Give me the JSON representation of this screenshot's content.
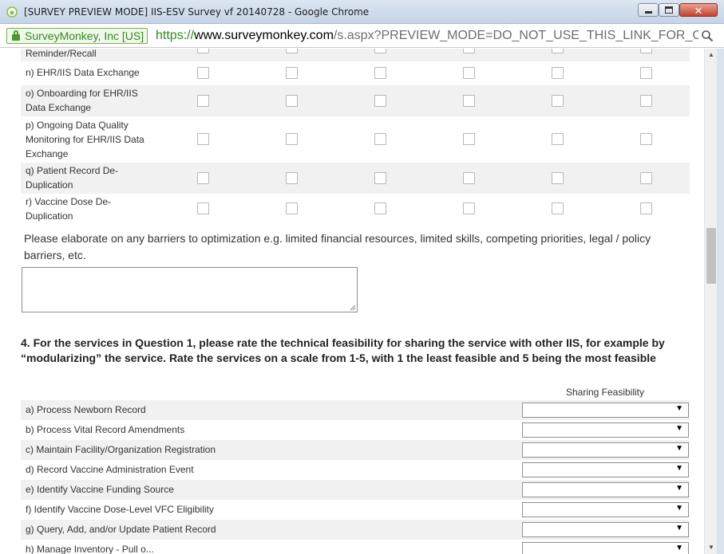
{
  "window": {
    "title": "[SURVEY PREVIEW MODE] IIS-ESV Survey vf 20140728 - Google Chrome",
    "close_glyph": "✕"
  },
  "address": {
    "ev_label": "SurveyMonkey, Inc [US]",
    "scheme": "https://",
    "host": "www.surveymonkey.com",
    "path": "/s.aspx?PREVIEW_MODE=DO_NOT_USE_THIS_LINK_FOR_COLLECTION"
  },
  "matrix": {
    "rows": [
      {
        "label": "Reminder/Recall",
        "alt": true
      },
      {
        "label": "n) EHR/IIS Data Exchange",
        "alt": false
      },
      {
        "label": "o) Onboarding for EHR/IIS Data Exchange",
        "alt": true
      },
      {
        "label": "p) Ongoing Data Quality Monitoring for EHR/IIS Data Exchange",
        "alt": false
      },
      {
        "label": "q) Patient Record De-Duplication",
        "alt": true
      },
      {
        "label": "r) Vaccine Dose De-Duplication",
        "alt": false
      }
    ]
  },
  "elaborate_prompt": "Please elaborate on any barriers to optimization e.g. limited financial resources, limited skills, competing priorities, legal / policy barriers, etc.",
  "question4": {
    "text": "4. For the services in Question 1, please rate the technical feasibility for sharing the service with other IIS, for example by “modularizing” the service. Rate the services on a scale from 1-5, with 1 the least feasible and 5 being the most feasible",
    "column_header": "Sharing Feasibility",
    "rows": [
      "a) Process Newborn Record",
      "b) Process Vital Record Amendments",
      "c) Maintain Facility/Organization Registration",
      "d) Record Vaccine Administration Event",
      "e) Identify Vaccine Funding Source",
      "f) Identify Vaccine Dose-Level VFC Eligibility",
      "g) Query, Add, and/or Update Patient Record",
      "h) Manage Inventory - Pull o..."
    ],
    "dropdown_arrow": "▼"
  },
  "scrollbar": {
    "up": "▲",
    "down": "▼"
  }
}
